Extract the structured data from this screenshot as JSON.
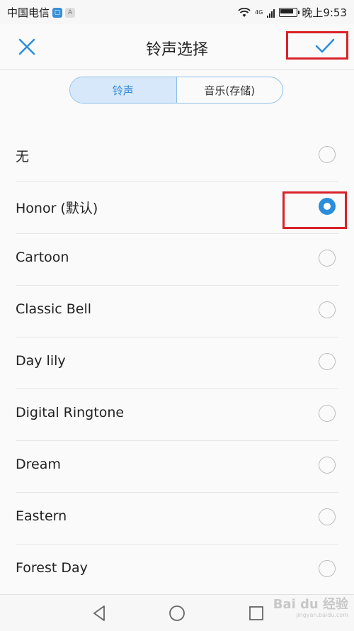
{
  "status_bar": {
    "carrier": "中国电信",
    "network": "4G",
    "time": "晚上9:53"
  },
  "header": {
    "title": "铃声选择"
  },
  "tabs": [
    {
      "label": "铃声",
      "active": true
    },
    {
      "label": "音乐(存储)",
      "active": false
    }
  ],
  "ringtones": [
    {
      "label": "无",
      "selected": false
    },
    {
      "label": "Honor (默认)",
      "selected": true
    },
    {
      "label": "Cartoon",
      "selected": false
    },
    {
      "label": "Classic Bell",
      "selected": false
    },
    {
      "label": "Day lily",
      "selected": false
    },
    {
      "label": "Digital Ringtone",
      "selected": false
    },
    {
      "label": "Dream",
      "selected": false
    },
    {
      "label": "Eastern",
      "selected": false
    },
    {
      "label": "Forest Day",
      "selected": false
    }
  ],
  "watermark": {
    "text": "Bai du 经验",
    "sub": "jingyan.baidu.com"
  },
  "colors": {
    "accent": "#2b8ddb",
    "highlight": "#d9222a"
  }
}
